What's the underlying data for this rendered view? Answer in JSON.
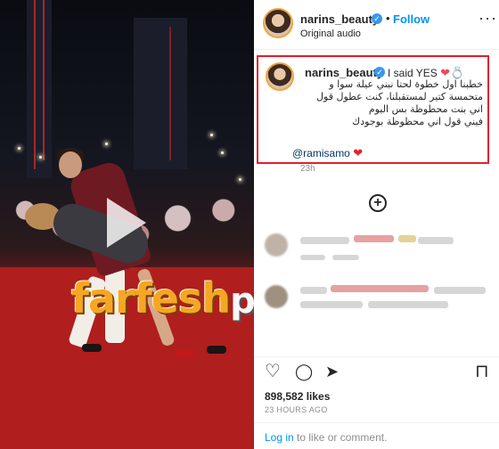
{
  "watermark": {
    "main": "farfesh",
    "suffix": "plus.com"
  },
  "header": {
    "username": "narins_beauty",
    "verified_glyph": "✓",
    "separator": "•",
    "follow_label": "Follow",
    "subtitle": "Original audio",
    "more_glyph": "···"
  },
  "caption": {
    "username": "narins_beauty",
    "verified_glyph": "✓",
    "text": "I said YES",
    "emoji": "❤💍",
    "arabic_lines": [
      "خطبنا اول خطوة لحتا نبني عيلة سوا و",
      "متحمسة كتير لمستقبلنا، كنت عطول قول",
      "اني بنت محظوظة بس اليوم",
      "فيني قول اني محظوظة بوجودك"
    ],
    "mention": "@ramisamo",
    "mention_emoji": "❤",
    "time": "23h"
  },
  "add_glyph": "+",
  "actions": {
    "like_glyph": "♡",
    "comment_glyph": "◯",
    "share_glyph": "➤",
    "save_glyph": "⊓"
  },
  "stats": {
    "likes": "898,582 likes",
    "posted": "23 HOURS AGO"
  },
  "footer": {
    "login_link": "Log in",
    "login_rest": " to like or comment."
  },
  "colors": {
    "accent_blue": "#0095f6",
    "highlight_red": "#e0212c",
    "watermark_orange": "#f5a623"
  }
}
